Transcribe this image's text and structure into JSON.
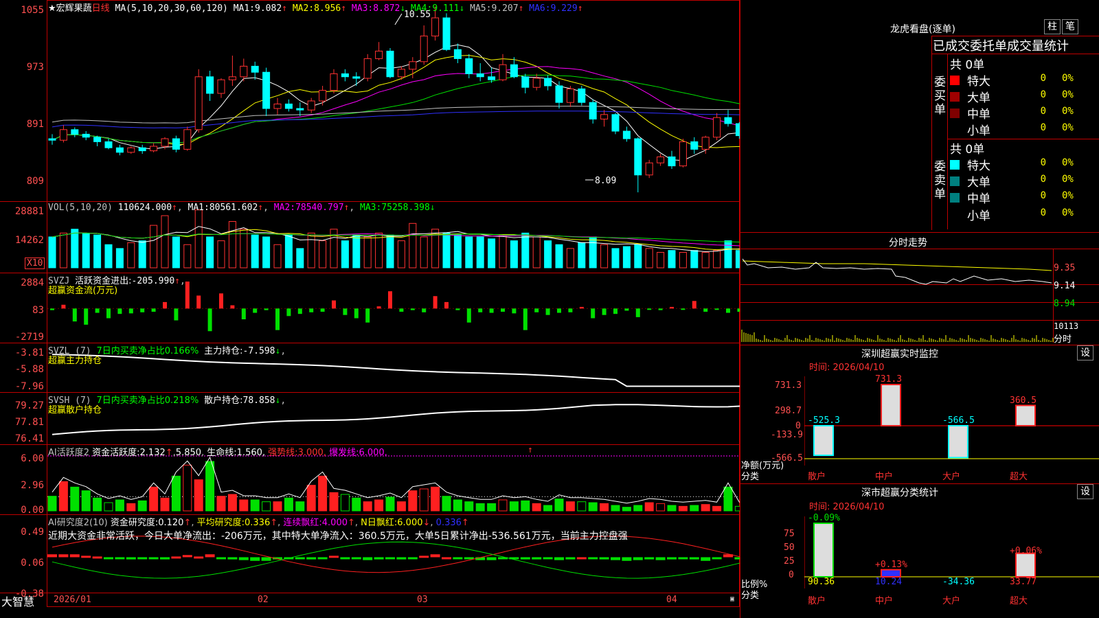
{
  "colors": {
    "up": "#ff3232",
    "down": "#00ffff",
    "border": "#c00000",
    "yellow": "#ffff00",
    "white": "#ffffff",
    "magenta": "#ff00ff",
    "green": "#00e000",
    "blue": "#3030ff",
    "axis": "#ff5050"
  },
  "price_panel": {
    "stock": "★宏辉果蔬",
    "period": "日线",
    "ma_label": "MA(5,10,20,30,60,120)",
    "ma": [
      {
        "name": "MA1:",
        "value": "9.082",
        "arrow": "↑",
        "color": "#ffffff"
      },
      {
        "name": "MA2:",
        "value": "8.956",
        "arrow": "↑",
        "color": "#ffff00"
      },
      {
        "name": "MA3:",
        "value": "8.872",
        "arrow": "↓",
        "color": "#ff00ff"
      },
      {
        "name": "MA4:",
        "value": "9.111",
        "arrow": "↓",
        "color": "#00ff00"
      },
      {
        "name": "MA5:",
        "value": "9.207",
        "arrow": "↑",
        "color": "#c0c0c0"
      },
      {
        "name": "MA6:",
        "value": "9.229",
        "arrow": "↑",
        "color": "#3030ff"
      }
    ],
    "y_ticks": [
      "1055",
      "973",
      "891",
      "809"
    ],
    "high_mark": "10.55",
    "low_mark": "8.09"
  },
  "vol_panel": {
    "label": "VOL(5,10,20)",
    "value": "110624.000",
    "arrow": "↑",
    "ma": [
      {
        "name": "MA1:",
        "value": "80561.602",
        "arrow": "↑",
        "color": "#ffffff"
      },
      {
        "name": "MA2:",
        "value": "78540.797",
        "arrow": "↑",
        "color": "#ff00ff"
      },
      {
        "name": "MA3:",
        "value": "75258.398",
        "arrow": "↓",
        "color": "#00ff00"
      }
    ],
    "y_ticks": [
      "28881",
      "14262"
    ],
    "unit": "X10"
  },
  "svzj_panel": {
    "label": "SVZJ",
    "title": "活跃资金进出:",
    "value": "-205.990",
    "arrow": "↑",
    "sub": "超赢资金流(万元)",
    "y_ticks": [
      "2884",
      "83",
      "-2719"
    ]
  },
  "svzl_panel": {
    "label": "SVZL (7)",
    "green_text": "7日内买卖净占比0.166%",
    "name": "主力持仓:",
    "value": "-7.598",
    "arrow": "↓",
    "sub": "超赢主力持仓",
    "y_ticks": [
      "-3.81",
      "-5.88",
      "-7.96"
    ]
  },
  "svsh_panel": {
    "label": "SVSH (7)",
    "green_text": "7日内买卖净占比0.218%",
    "name": "散户持仓:",
    "value": "78.858",
    "arrow": "↓",
    "sub": "超赢散户持仓",
    "y_ticks": [
      "79.27",
      "77.81",
      "76.41"
    ]
  },
  "ai1_panel": {
    "label": "AI活跃度2",
    "t1": "资金活跃度:",
    "v1": "2.132",
    "a1": "↑",
    "v2": "5.850",
    "t3": "生命线:",
    "v3": "1.560,",
    "t4": "强势线:",
    "v4": "3.000,",
    "t5": "爆发线:",
    "v5": "6.000,",
    "a5": "↑",
    "y_ticks": [
      "6.00",
      "2.96",
      "0.00"
    ]
  },
  "ai2_panel": {
    "label": "AI研究度2(10)",
    "t1": "资金研究度:",
    "v1": "0.120",
    "a1": "↑",
    "t2": "平均研究度:",
    "v2": "0.336",
    "a2": "↑",
    "t3": "连续飘红:",
    "v3": "4.000",
    "a3": "↑",
    "t4": "N日飘红:",
    "v4": "6.000",
    "a4": "↓",
    "v5": "0.336",
    "a5": "↑",
    "summary": "近期大资金非常活跃，今日大单净流出：-206万元，其中特大单净流入：360.5万元，大单5日累计净出-536.561万元，当前主力控盘强",
    "y_ticks": [
      "0.49",
      "0.06",
      "-0.38"
    ]
  },
  "bottom_bar": {
    "brand": "大智慧",
    "dates": [
      "2026/01",
      "02",
      "03",
      "04"
    ],
    "lock_icon": "lock-icon"
  },
  "right_panel": {
    "title": "龙虎看盘(逐单)",
    "btn1": "柱",
    "btn2": "笔",
    "header": "已成交委托单成交量统计",
    "buy": {
      "side_label": "委买单",
      "count": "共 0单",
      "rows": [
        {
          "label": "特大",
          "value": "0",
          "pct": "0%",
          "color": "#ff0000"
        },
        {
          "label": "大单",
          "value": "0",
          "pct": "0%",
          "color": "#a00000"
        },
        {
          "label": "中单",
          "value": "0",
          "pct": "0%",
          "color": "#800000"
        },
        {
          "label": "小单",
          "value": "0",
          "pct": "0%",
          "color": ""
        }
      ]
    },
    "sell": {
      "side_label": "委卖单",
      "count": "共 0单",
      "rows": [
        {
          "label": "特大",
          "value": "0",
          "pct": "0%",
          "color": "#00ffff"
        },
        {
          "label": "大单",
          "value": "0",
          "pct": "0%",
          "color": "#008080"
        },
        {
          "label": "中单",
          "value": "0",
          "pct": "0%",
          "color": "#008080"
        },
        {
          "label": "小单",
          "value": "0",
          "pct": "0%",
          "color": ""
        }
      ]
    },
    "intraday": {
      "title": "分时走势",
      "ticks": [
        "9.35",
        "9.14",
        "8.94"
      ],
      "vol_tick": "10113",
      "vol_label": "分时"
    },
    "sz_monitor": {
      "title": "深圳超赢实时监控",
      "set": "设",
      "time": "时间: 2026/04/10",
      "y_ticks": [
        "731.3",
        "298.7",
        "0",
        "-133.9",
        "-566.5"
      ],
      "y_label": "净额(万元)",
      "x_label": "分类",
      "categories": [
        "散户",
        "中户",
        "大户",
        "超大"
      ],
      "values": [
        -525.3,
        731.3,
        -566.5,
        360.5
      ],
      "value_labels": [
        "-525.3",
        "731.3",
        "-566.5",
        "360.5"
      ]
    },
    "sz_class": {
      "title": "深市超赢分类统计",
      "set": "设",
      "time": "时间: 2026/04/10",
      "y_ticks": [
        "75",
        "50",
        "25",
        "0"
      ],
      "y_label": "比例%",
      "x_label": "分类",
      "categories": [
        "散户",
        "中户",
        "大户",
        "超大"
      ],
      "pct_labels": [
        "-0.09%",
        "+0.13%",
        "",
        "+0.06%"
      ],
      "bottom_values": [
        "90.36",
        "10.24",
        "-34.36",
        "33.77"
      ],
      "values": [
        90.36,
        10.24,
        -34.36,
        33.77
      ]
    }
  },
  "chart_data": {
    "type": "candlestick",
    "candles": [
      [
        8.8,
        8.86,
        8.72,
        8.78
      ],
      [
        8.78,
        8.98,
        8.75,
        8.92
      ],
      [
        8.92,
        8.95,
        8.82,
        8.86
      ],
      [
        8.86,
        8.9,
        8.78,
        8.82
      ],
      [
        8.82,
        8.84,
        8.7,
        8.76
      ],
      [
        8.76,
        8.8,
        8.66,
        8.68
      ],
      [
        8.68,
        8.72,
        8.58,
        8.62
      ],
      [
        8.62,
        8.7,
        8.6,
        8.68
      ],
      [
        8.68,
        8.72,
        8.6,
        8.64
      ],
      [
        8.64,
        8.74,
        8.62,
        8.7
      ],
      [
        8.7,
        8.82,
        8.66,
        8.8
      ],
      [
        8.8,
        8.84,
        8.62,
        8.66
      ],
      [
        8.66,
        8.96,
        8.64,
        8.92
      ],
      [
        8.92,
        9.72,
        8.88,
        9.62
      ],
      [
        9.62,
        9.7,
        9.3,
        9.4
      ],
      [
        9.4,
        9.6,
        9.34,
        9.58
      ],
      [
        9.58,
        9.9,
        9.5,
        9.62
      ],
      [
        9.62,
        9.86,
        9.56,
        9.76
      ],
      [
        9.76,
        9.82,
        9.58,
        9.68
      ],
      [
        9.68,
        9.74,
        9.1,
        9.2
      ],
      [
        9.2,
        9.34,
        9.12,
        9.26
      ],
      [
        9.26,
        9.32,
        9.16,
        9.2
      ],
      [
        9.2,
        9.28,
        9.1,
        9.18
      ],
      [
        9.18,
        9.34,
        9.14,
        9.3
      ],
      [
        9.3,
        9.5,
        9.24,
        9.44
      ],
      [
        9.44,
        9.72,
        9.4,
        9.66
      ],
      [
        9.66,
        9.72,
        9.56,
        9.62
      ],
      [
        9.62,
        9.68,
        9.5,
        9.6
      ],
      [
        9.6,
        9.92,
        9.56,
        9.86
      ],
      [
        9.86,
        10.08,
        9.84,
        9.96
      ],
      [
        9.96,
        10.0,
        9.6,
        9.62
      ],
      [
        9.62,
        9.76,
        9.58,
        9.72
      ],
      [
        9.72,
        9.88,
        9.6,
        9.82
      ],
      [
        9.82,
        10.3,
        9.78,
        10.16
      ],
      [
        10.16,
        10.55,
        10.1,
        10.4
      ],
      [
        10.4,
        10.46,
        9.96,
        9.98
      ],
      [
        9.98,
        10.06,
        9.8,
        9.86
      ],
      [
        9.86,
        9.92,
        9.6,
        9.66
      ],
      [
        9.66,
        9.8,
        9.56,
        9.62
      ],
      [
        9.62,
        9.74,
        9.54,
        9.58
      ],
      [
        9.58,
        9.92,
        9.56,
        9.78
      ],
      [
        9.78,
        9.88,
        9.6,
        9.62
      ],
      [
        9.62,
        9.66,
        9.4,
        9.48
      ],
      [
        9.48,
        9.66,
        9.44,
        9.6
      ],
      [
        9.6,
        9.64,
        9.44,
        9.5
      ],
      [
        9.5,
        9.56,
        9.2,
        9.28
      ],
      [
        9.28,
        9.5,
        9.22,
        9.46
      ],
      [
        9.46,
        9.5,
        9.24,
        9.28
      ],
      [
        9.28,
        9.32,
        9.0,
        9.06
      ],
      [
        9.06,
        9.18,
        8.96,
        9.12
      ],
      [
        9.12,
        9.14,
        8.86,
        8.9
      ],
      [
        8.9,
        8.96,
        8.76,
        8.8
      ],
      [
        8.8,
        8.82,
        8.09,
        8.32
      ],
      [
        8.32,
        8.52,
        8.28,
        8.48
      ],
      [
        8.48,
        8.6,
        8.44,
        8.56
      ],
      [
        8.56,
        8.64,
        8.4,
        8.44
      ],
      [
        8.44,
        8.8,
        8.42,
        8.76
      ],
      [
        8.76,
        8.82,
        8.6,
        8.66
      ],
      [
        8.66,
        8.84,
        8.6,
        8.82
      ],
      [
        8.82,
        9.14,
        8.78,
        9.08
      ],
      [
        9.08,
        9.18,
        8.96,
        9.0
      ],
      [
        9.0,
        9.02,
        8.8,
        8.84
      ],
      [
        8.84,
        9.0,
        8.82,
        8.96
      ],
      [
        8.96,
        9.3,
        8.94,
        9.24
      ],
      [
        9.24,
        9.32,
        9.02,
        9.04
      ],
      [
        9.04,
        9.18,
        8.98,
        9.1
      ],
      [
        9.1,
        9.6,
        9.06,
        9.12
      ]
    ],
    "ylim": [
      8.0,
      10.6
    ],
    "volume": [
      16,
      18,
      20,
      18,
      17,
      12,
      10,
      13,
      14,
      22,
      27,
      16,
      12,
      30,
      16,
      14,
      24,
      20,
      17,
      16,
      12,
      17,
      10,
      18,
      14,
      20,
      14,
      17,
      16,
      18,
      17,
      14,
      23,
      16,
      20,
      18,
      17,
      16,
      16,
      15,
      17,
      14,
      18,
      16,
      14,
      12,
      10,
      13,
      16,
      12,
      10,
      11,
      12,
      10,
      8,
      9,
      8,
      9,
      8,
      9,
      14,
      9,
      10,
      8,
      10,
      12,
      13
    ],
    "vol_ylim": [
      0,
      32
    ],
    "svzj": [
      -150,
      350,
      -1200,
      -1500,
      -400,
      -900,
      -500,
      -450,
      -350,
      -300,
      600,
      -1100,
      2500,
      1200,
      -2100,
      1400,
      300,
      -1000,
      -400,
      -150,
      -2000,
      -700,
      -500,
      -350,
      -300,
      750,
      -600,
      -900,
      -1300,
      200,
      1600,
      -300,
      -150,
      -350,
      1150,
      600,
      -150,
      -1300,
      -350,
      -400,
      -300,
      -450,
      -2000,
      -350,
      -600,
      -400,
      -350,
      150,
      -900,
      -600,
      -500,
      -200,
      -800,
      -100,
      -150,
      150,
      -100,
      700,
      -300,
      -100,
      -400,
      -300,
      -500,
      1600,
      -200,
      -500,
      -150,
      -500,
      -300,
      700,
      -200,
      -600,
      -300
    ],
    "svzj_ylim": [
      -2719,
      2884
    ]
  }
}
